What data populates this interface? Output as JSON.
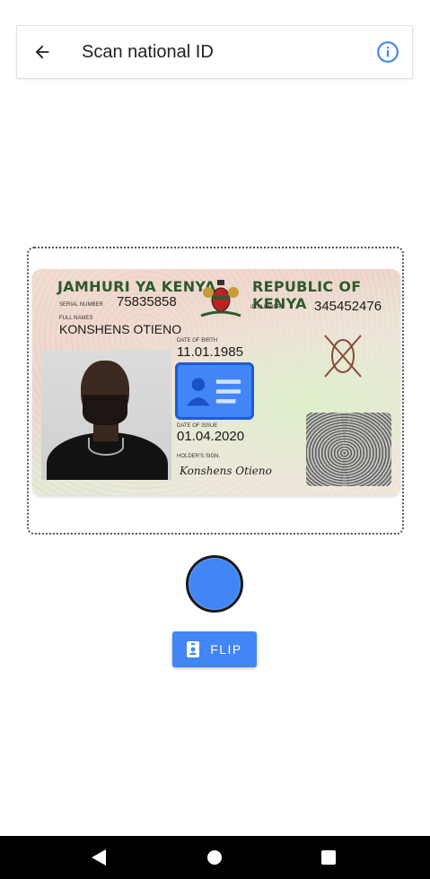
{
  "app_bar": {
    "title": "Scan national ID",
    "back_icon": "arrow-back-icon",
    "info_icon": "info-icon"
  },
  "id_card": {
    "header_left": "JAMHURI YA KENYA",
    "header_right": "REPUBLIC OF KENYA",
    "serial_label": "SERIAL NUMBER",
    "serial_number": "75835858",
    "id_label": "ID NUMBER",
    "id_number": "345452476",
    "names_label": "FULL NAMES",
    "full_name": "KONSHENS OTIENO",
    "dob_label": "DATE OF BIRTH",
    "dob": "11.01.1985",
    "issue_label": "DATE OF ISSUE",
    "issue_date": "01.04.2020",
    "sign_label": "HOLDER'S SIGN.",
    "signature": "Konshens Otieno"
  },
  "flip_button": {
    "label": "FLIP",
    "icon": "badge-icon"
  },
  "colors": {
    "primary": "#4285f4",
    "card_green": "#2d5a2d"
  },
  "nav_bar": {
    "back_icon": "nav-back-icon",
    "home_icon": "nav-home-icon",
    "recent_icon": "nav-recent-icon"
  }
}
